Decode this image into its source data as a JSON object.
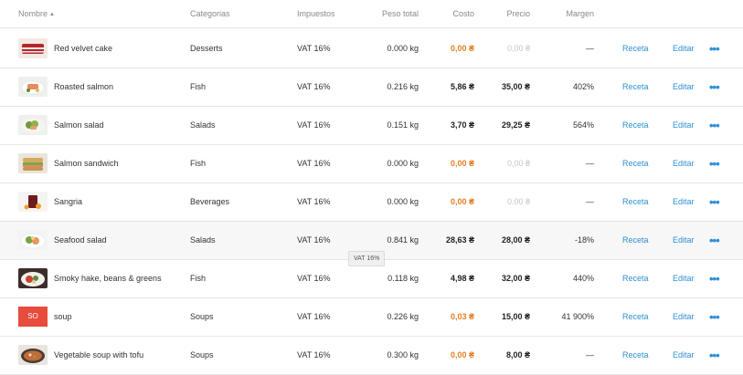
{
  "columns": {
    "name": "Nombre",
    "category": "Categorias",
    "tax": "Impuestos",
    "weight": "Peso total",
    "cost": "Costo",
    "price": "Precio",
    "margin": "Margen"
  },
  "row_actions": {
    "recipe": "Receta",
    "edit": "Editar",
    "more": "•••"
  },
  "tooltip": "VAT 16%",
  "colors": {
    "accent": "#2d8fd8",
    "warning": "#e67e22",
    "muted": "#c6c6c6",
    "badge": "#e74c3c"
  },
  "rows": [
    {
      "name": "Red velvet cake",
      "category": "Desserts",
      "tax": "VAT 16%",
      "weight": "0.000 kg",
      "cost": "0,00 ₴",
      "cost_state": "warn",
      "price": "0,00 ₴",
      "price_state": "muted",
      "margin": "—",
      "thumb": "cake"
    },
    {
      "name": "Roasted salmon",
      "category": "Fish",
      "tax": "VAT 16%",
      "weight": "0.216 kg",
      "cost": "5,86 ₴",
      "cost_state": "normal",
      "price": "35,00 ₴",
      "price_state": "normal",
      "margin": "402%",
      "thumb": "salmon"
    },
    {
      "name": "Salmon salad",
      "category": "Salads",
      "tax": "VAT 16%",
      "weight": "0.151 kg",
      "cost": "3,70 ₴",
      "cost_state": "normal",
      "price": "29,25 ₴",
      "price_state": "normal",
      "margin": "564%",
      "thumb": "salad"
    },
    {
      "name": "Salmon sandwich",
      "category": "Fish",
      "tax": "VAT 16%",
      "weight": "0.000 kg",
      "cost": "0,00 ₴",
      "cost_state": "warn",
      "price": "0,00 ₴",
      "price_state": "muted",
      "margin": "—",
      "thumb": "sandwich"
    },
    {
      "name": "Sangria",
      "category": "Beverages",
      "tax": "VAT 16%",
      "weight": "0.000 kg",
      "cost": "0,00 ₴",
      "cost_state": "warn",
      "price": "0,00 ₴",
      "price_state": "muted",
      "margin": "—",
      "thumb": "drink"
    },
    {
      "name": "Seafood salad",
      "category": "Salads",
      "tax": "VAT 16%",
      "weight": "0.841 kg",
      "cost": "28,63 ₴",
      "cost_state": "normal",
      "price": "28,00 ₴",
      "price_state": "normal",
      "margin": "-18%",
      "thumb": "seafood",
      "highlight": true
    },
    {
      "name": "Smoky hake, beans & greens",
      "category": "Fish",
      "tax": "VAT 16%",
      "weight": "0.118 kg",
      "cost": "4,98 ₴",
      "cost_state": "normal",
      "price": "32,00 ₴",
      "price_state": "normal",
      "margin": "440%",
      "thumb": "hake"
    },
    {
      "name": "soup",
      "category": "Soups",
      "tax": "VAT 16%",
      "weight": "0.226 kg",
      "cost": "0,03 ₴",
      "cost_state": "warn",
      "price": "15,00 ₴",
      "price_state": "normal",
      "margin": "41 900%",
      "initials": "SO"
    },
    {
      "name": "Vegetable soup with tofu",
      "category": "Soups",
      "tax": "VAT 16%",
      "weight": "0.300 kg",
      "cost": "0,00 ₴",
      "cost_state": "warn",
      "price": "8,00 ₴",
      "price_state": "normal",
      "margin": "—",
      "thumb": "soup"
    }
  ]
}
